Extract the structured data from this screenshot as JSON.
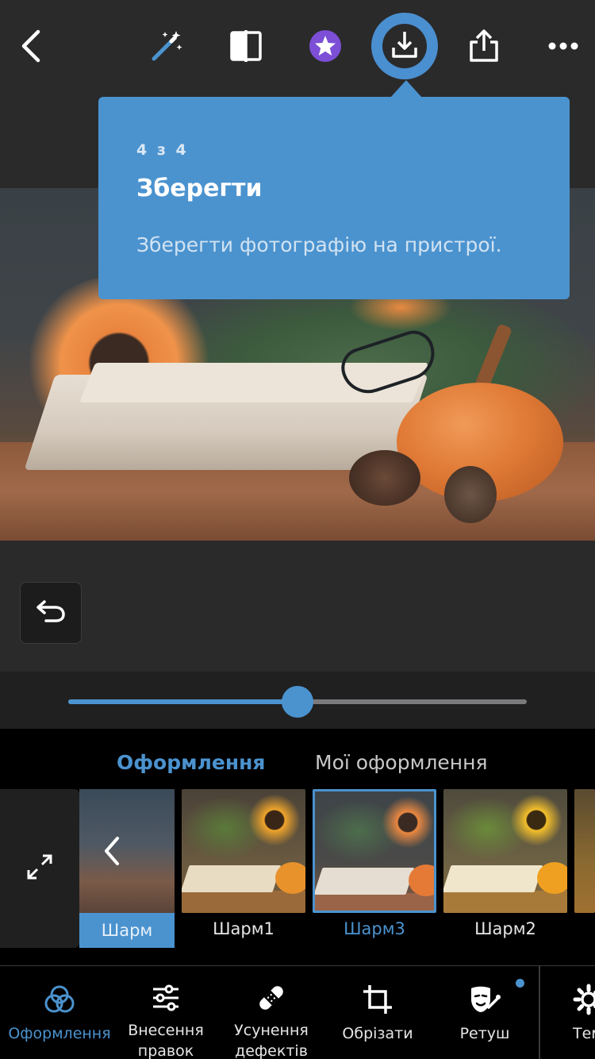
{
  "colors": {
    "accent": "#4b93cf",
    "background": "#2a2a2b",
    "panel": "#000000",
    "premium": "#7c4fd6"
  },
  "toolbar": {
    "icons": [
      "back-icon",
      "magic-wand-icon",
      "compare-icon",
      "premium-star-icon",
      "download-icon",
      "share-icon",
      "more-icon"
    ]
  },
  "tooltip": {
    "step": "4 з 4",
    "title": "Зберегти",
    "description": "Зберегти фотографію на пристрої."
  },
  "slider": {
    "value_fraction": 0.5
  },
  "looks_tabs": [
    {
      "label": "Оформлення",
      "active": true
    },
    {
      "label": "Мої оформлення",
      "active": false
    }
  ],
  "looks": {
    "group_label": "Шарм",
    "items": [
      {
        "label": "Шарм1",
        "selected": false,
        "tone": "warm"
      },
      {
        "label": "Шарм3",
        "selected": true,
        "tone": "cool"
      },
      {
        "label": "Шарм2",
        "selected": false,
        "tone": "bright"
      }
    ]
  },
  "bottom_nav": [
    {
      "label": "Оформлення",
      "icon": "looks-icon",
      "active": true
    },
    {
      "label": "Внесення правок",
      "icon": "sliders-icon",
      "active": false
    },
    {
      "label": "Усунення дефектів",
      "icon": "bandage-icon",
      "active": false
    },
    {
      "label": "Обрізати",
      "icon": "crop-icon",
      "active": false
    },
    {
      "label": "Ретуш",
      "icon": "retouch-icon",
      "active": false,
      "badge": true
    },
    {
      "label": "Тем",
      "icon": "gear-icon",
      "active": false
    }
  ]
}
